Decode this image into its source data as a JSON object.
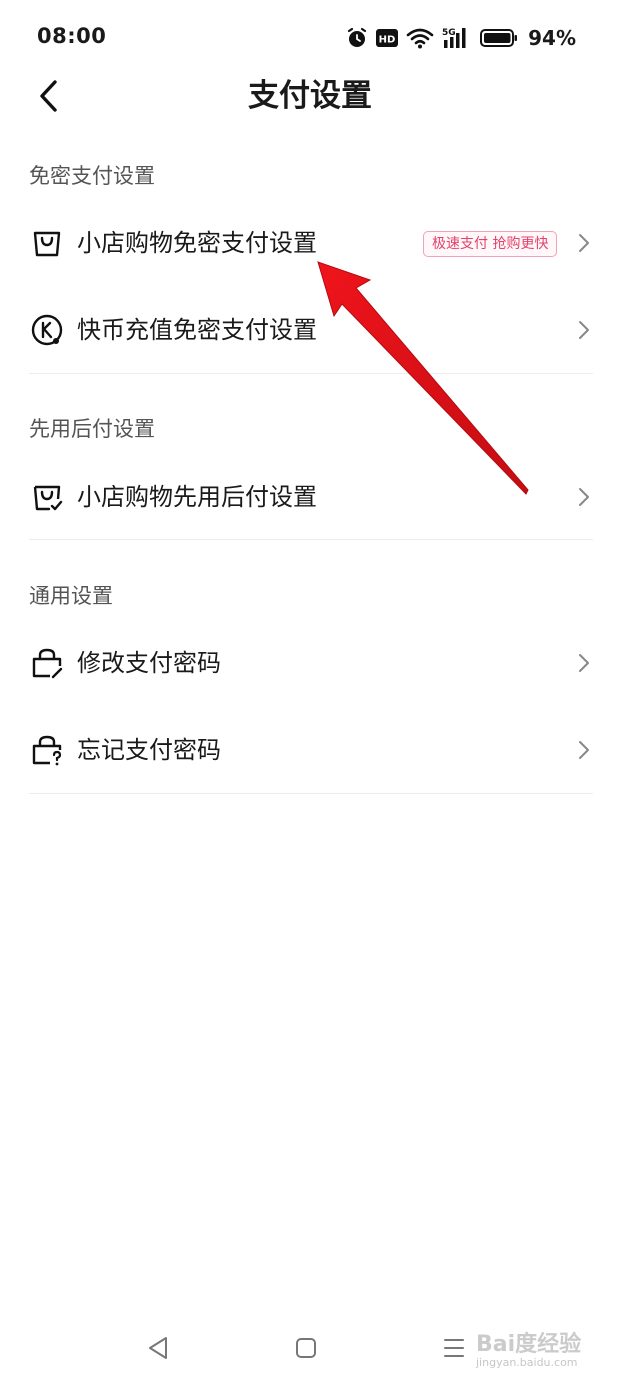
{
  "status_bar": {
    "time": "08:00",
    "battery": "94%",
    "icons": [
      "alarm-icon",
      "hd-icon",
      "wifi-icon",
      "signal-5g-icon",
      "battery-icon"
    ]
  },
  "header": {
    "title": "支付设置",
    "back_icon": "chevron-left-icon"
  },
  "sections": [
    {
      "title": "免密支付设置",
      "items": [
        {
          "label": "小店购物免密支付设置",
          "icon": "shopping-bag-icon",
          "badge": "极速支付 抢购更快"
        },
        {
          "label": "快币充值免密支付设置",
          "icon": "kuaibi-coin-icon"
        }
      ]
    },
    {
      "title": "先用后付设置",
      "items": [
        {
          "label": "小店购物先用后付设置",
          "icon": "shopping-bag-check-icon"
        }
      ]
    },
    {
      "title": "通用设置",
      "items": [
        {
          "label": "修改支付密码",
          "icon": "lock-edit-icon"
        },
        {
          "label": "忘记支付密码",
          "icon": "lock-question-icon"
        }
      ]
    }
  ],
  "annotation": {
    "color": "#e8141b",
    "points_to": "小店购物免密支付设置"
  },
  "system_nav": {
    "icons": [
      "back-triangle-icon",
      "home-square-icon",
      "menu-lines-icon"
    ]
  },
  "watermark": {
    "main": "Bai度经验",
    "sub": "jingyan.baidu.com"
  },
  "colors": {
    "badge_text": "#e3436b",
    "badge_border": "#f0a5b6",
    "section_header": "#555555",
    "divider": "#ececec"
  }
}
